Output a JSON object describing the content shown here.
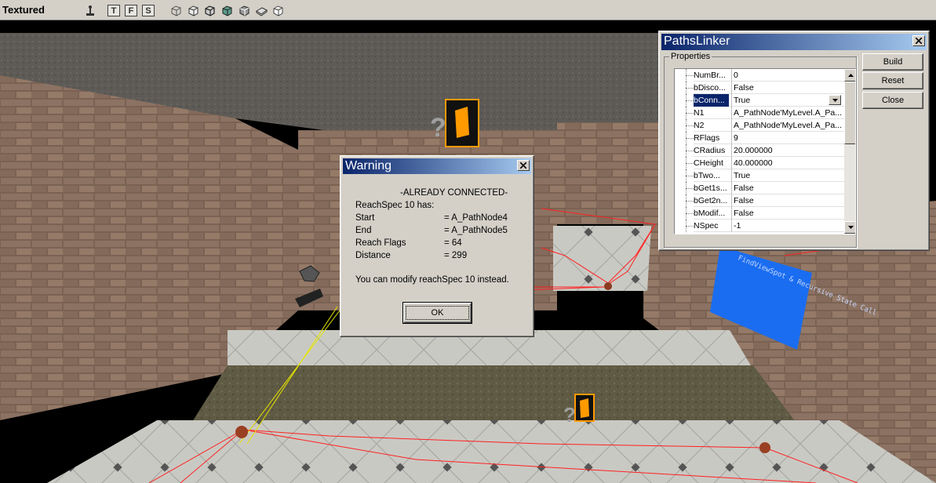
{
  "toolbar": {
    "viewport_mode": "Textured",
    "filter_buttons": [
      "T",
      "F",
      "S"
    ],
    "icons": [
      "actor-pin-icon",
      "wireframe-cube-icon",
      "cube-icon",
      "cube-icon",
      "textured-cube-icon",
      "cube-icon",
      "cube-icon",
      "cube-icon"
    ]
  },
  "scene": {
    "wall_sign_text": "FindViewSpot & Recursive State Call"
  },
  "warning": {
    "title": "Warning",
    "heading": "-ALREADY CONNECTED-",
    "intro": "ReachSpec 10 has:",
    "rows": [
      {
        "label": "Start",
        "value": "= A_PathNode4"
      },
      {
        "label": "End",
        "value": "= A_PathNode5"
      },
      {
        "label": "Reach Flags",
        "value": "= 64"
      },
      {
        "label": "Distance",
        "value": "= 299"
      }
    ],
    "footer": "You can modify reachSpec 10 instead.",
    "ok_label": "OK"
  },
  "paths_linker": {
    "title": "PathsLinker",
    "group_label": "Properties",
    "buttons": {
      "build": "Build",
      "reset": "Reset",
      "close": "Close"
    },
    "properties": [
      {
        "name": "NumBr...",
        "value": "0"
      },
      {
        "name": "bDisco...",
        "value": "False"
      },
      {
        "name": "bConn...",
        "value": "True",
        "selected": true
      },
      {
        "name": "N1",
        "value": "A_PathNode'MyLevel.A_Pa..."
      },
      {
        "name": "N2",
        "value": "A_PathNode'MyLevel.A_Pa..."
      },
      {
        "name": "RFlags",
        "value": "9"
      },
      {
        "name": "CRadius",
        "value": "20.000000"
      },
      {
        "name": "CHeight",
        "value": "40.000000"
      },
      {
        "name": "bTwo...",
        "value": "True"
      },
      {
        "name": "bGet1s...",
        "value": "False"
      },
      {
        "name": "bGet2n...",
        "value": "False"
      },
      {
        "name": "bModif...",
        "value": "False"
      },
      {
        "name": "NSpec",
        "value": "-1"
      }
    ]
  }
}
